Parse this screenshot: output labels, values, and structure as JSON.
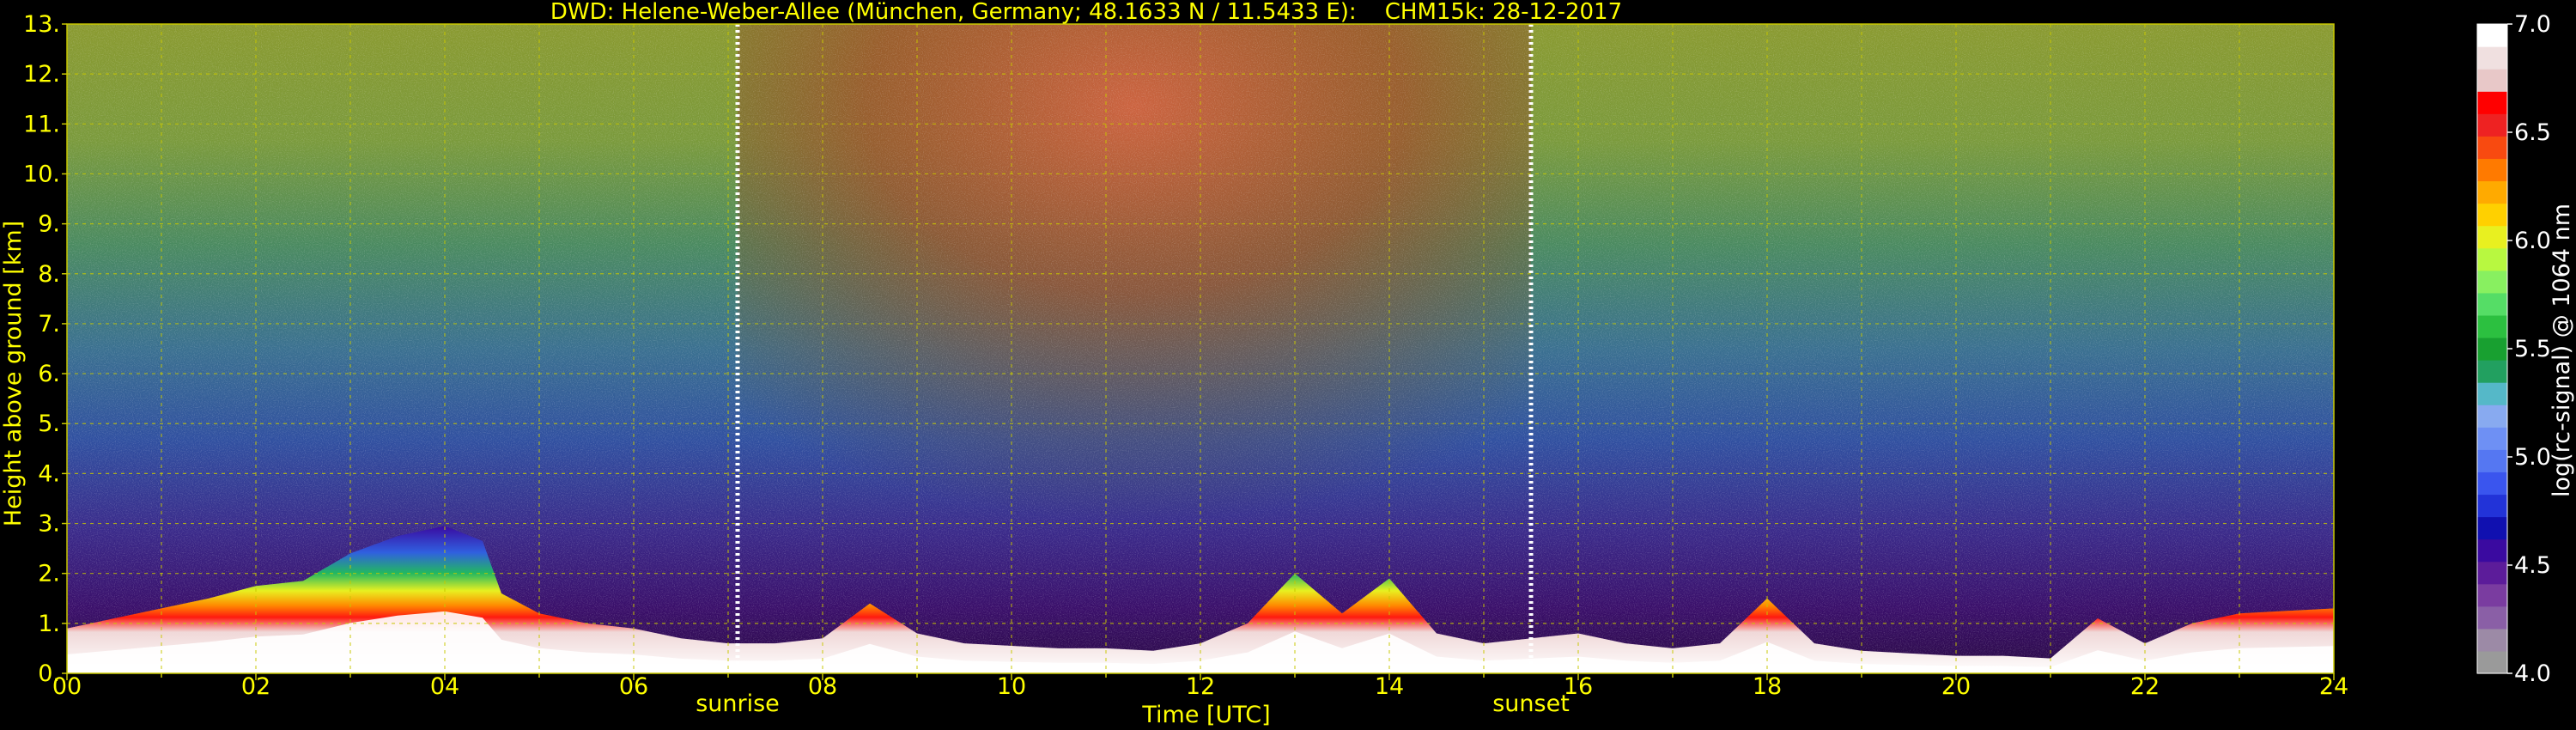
{
  "chart_data": {
    "type": "heatmap",
    "title": "DWD: Helene-Weber-Allee (München, Germany; 48.1633 N / 11.5433 E):    CHM15k: 28-12-2017",
    "xlabel": "Time [UTC]",
    "ylabel": "Height above ground [km]",
    "xlim": [
      0,
      24
    ],
    "ylim": [
      0,
      13
    ],
    "x_ticks": [
      "00",
      "02",
      "04",
      "06",
      "08",
      "10",
      "12",
      "14",
      "16",
      "18",
      "20",
      "22",
      "24"
    ],
    "y_ticks": [
      "0.",
      "1.",
      "2.",
      "3.",
      "4.",
      "5.",
      "6.",
      "7.",
      "8.",
      "9.",
      "10.",
      "11.",
      "12.",
      "13."
    ],
    "grid": true,
    "markers": [
      {
        "label": "sunrise",
        "x": 7.1
      },
      {
        "label": "sunset",
        "x": 15.5
      }
    ],
    "colorbar": {
      "label": "log(rc-signal) @ 1064 nm",
      "range": [
        4.0,
        7.0
      ],
      "ticks": [
        "4.0",
        "4.5",
        "5.0",
        "5.5",
        "6.0",
        "6.5",
        "7.0"
      ],
      "colors": [
        "#9a9a9a",
        "#9c8aa6",
        "#8a5fa6",
        "#7a3ca0",
        "#5c1c9a",
        "#3a0aa0",
        "#1010b0",
        "#2233d8",
        "#3a55ee",
        "#5577f2",
        "#6e90f4",
        "#88aaf0",
        "#55b8c8",
        "#22a060",
        "#18a030",
        "#2cc040",
        "#55dd66",
        "#88f060",
        "#b8f840",
        "#e8f020",
        "#ffd000",
        "#ffaa00",
        "#ff7a00",
        "#f84a10",
        "#ee2222",
        "#ff0000",
        "#e8c8c8",
        "#f0e0e0",
        "#ffffff"
      ]
    },
    "series": [
      {
        "name": "",
        "x": [
          0,
          0.5,
          1,
          1.5,
          2,
          2.5,
          3,
          3.5,
          4,
          4.4,
          4.6,
          5,
          5.5,
          6,
          6.5,
          7,
          7.5,
          8,
          8.5,
          9,
          9.5,
          10,
          10.5,
          11,
          11.5,
          12,
          12.5,
          13,
          13.5,
          14,
          14.5,
          15,
          15.5,
          16,
          16.5,
          17,
          17.5,
          18,
          18.5,
          19,
          19.5,
          20,
          20.5,
          21,
          21.5,
          22,
          22.5,
          23,
          23.5,
          24
        ],
        "values": [
          0.9,
          1.1,
          1.3,
          1.5,
          1.75,
          1.85,
          2.4,
          2.75,
          2.95,
          2.65,
          1.6,
          1.2,
          1.0,
          0.9,
          0.7,
          0.6,
          0.6,
          0.7,
          1.4,
          0.8,
          0.6,
          0.55,
          0.5,
          0.5,
          0.45,
          0.6,
          1.0,
          2.0,
          1.2,
          1.9,
          0.8,
          0.6,
          0.7,
          0.8,
          0.6,
          0.5,
          0.6,
          1.5,
          0.6,
          0.45,
          0.4,
          0.35,
          0.35,
          0.3,
          1.1,
          0.6,
          1.0,
          1.2,
          1.25,
          1.3
        ]
      }
    ]
  }
}
